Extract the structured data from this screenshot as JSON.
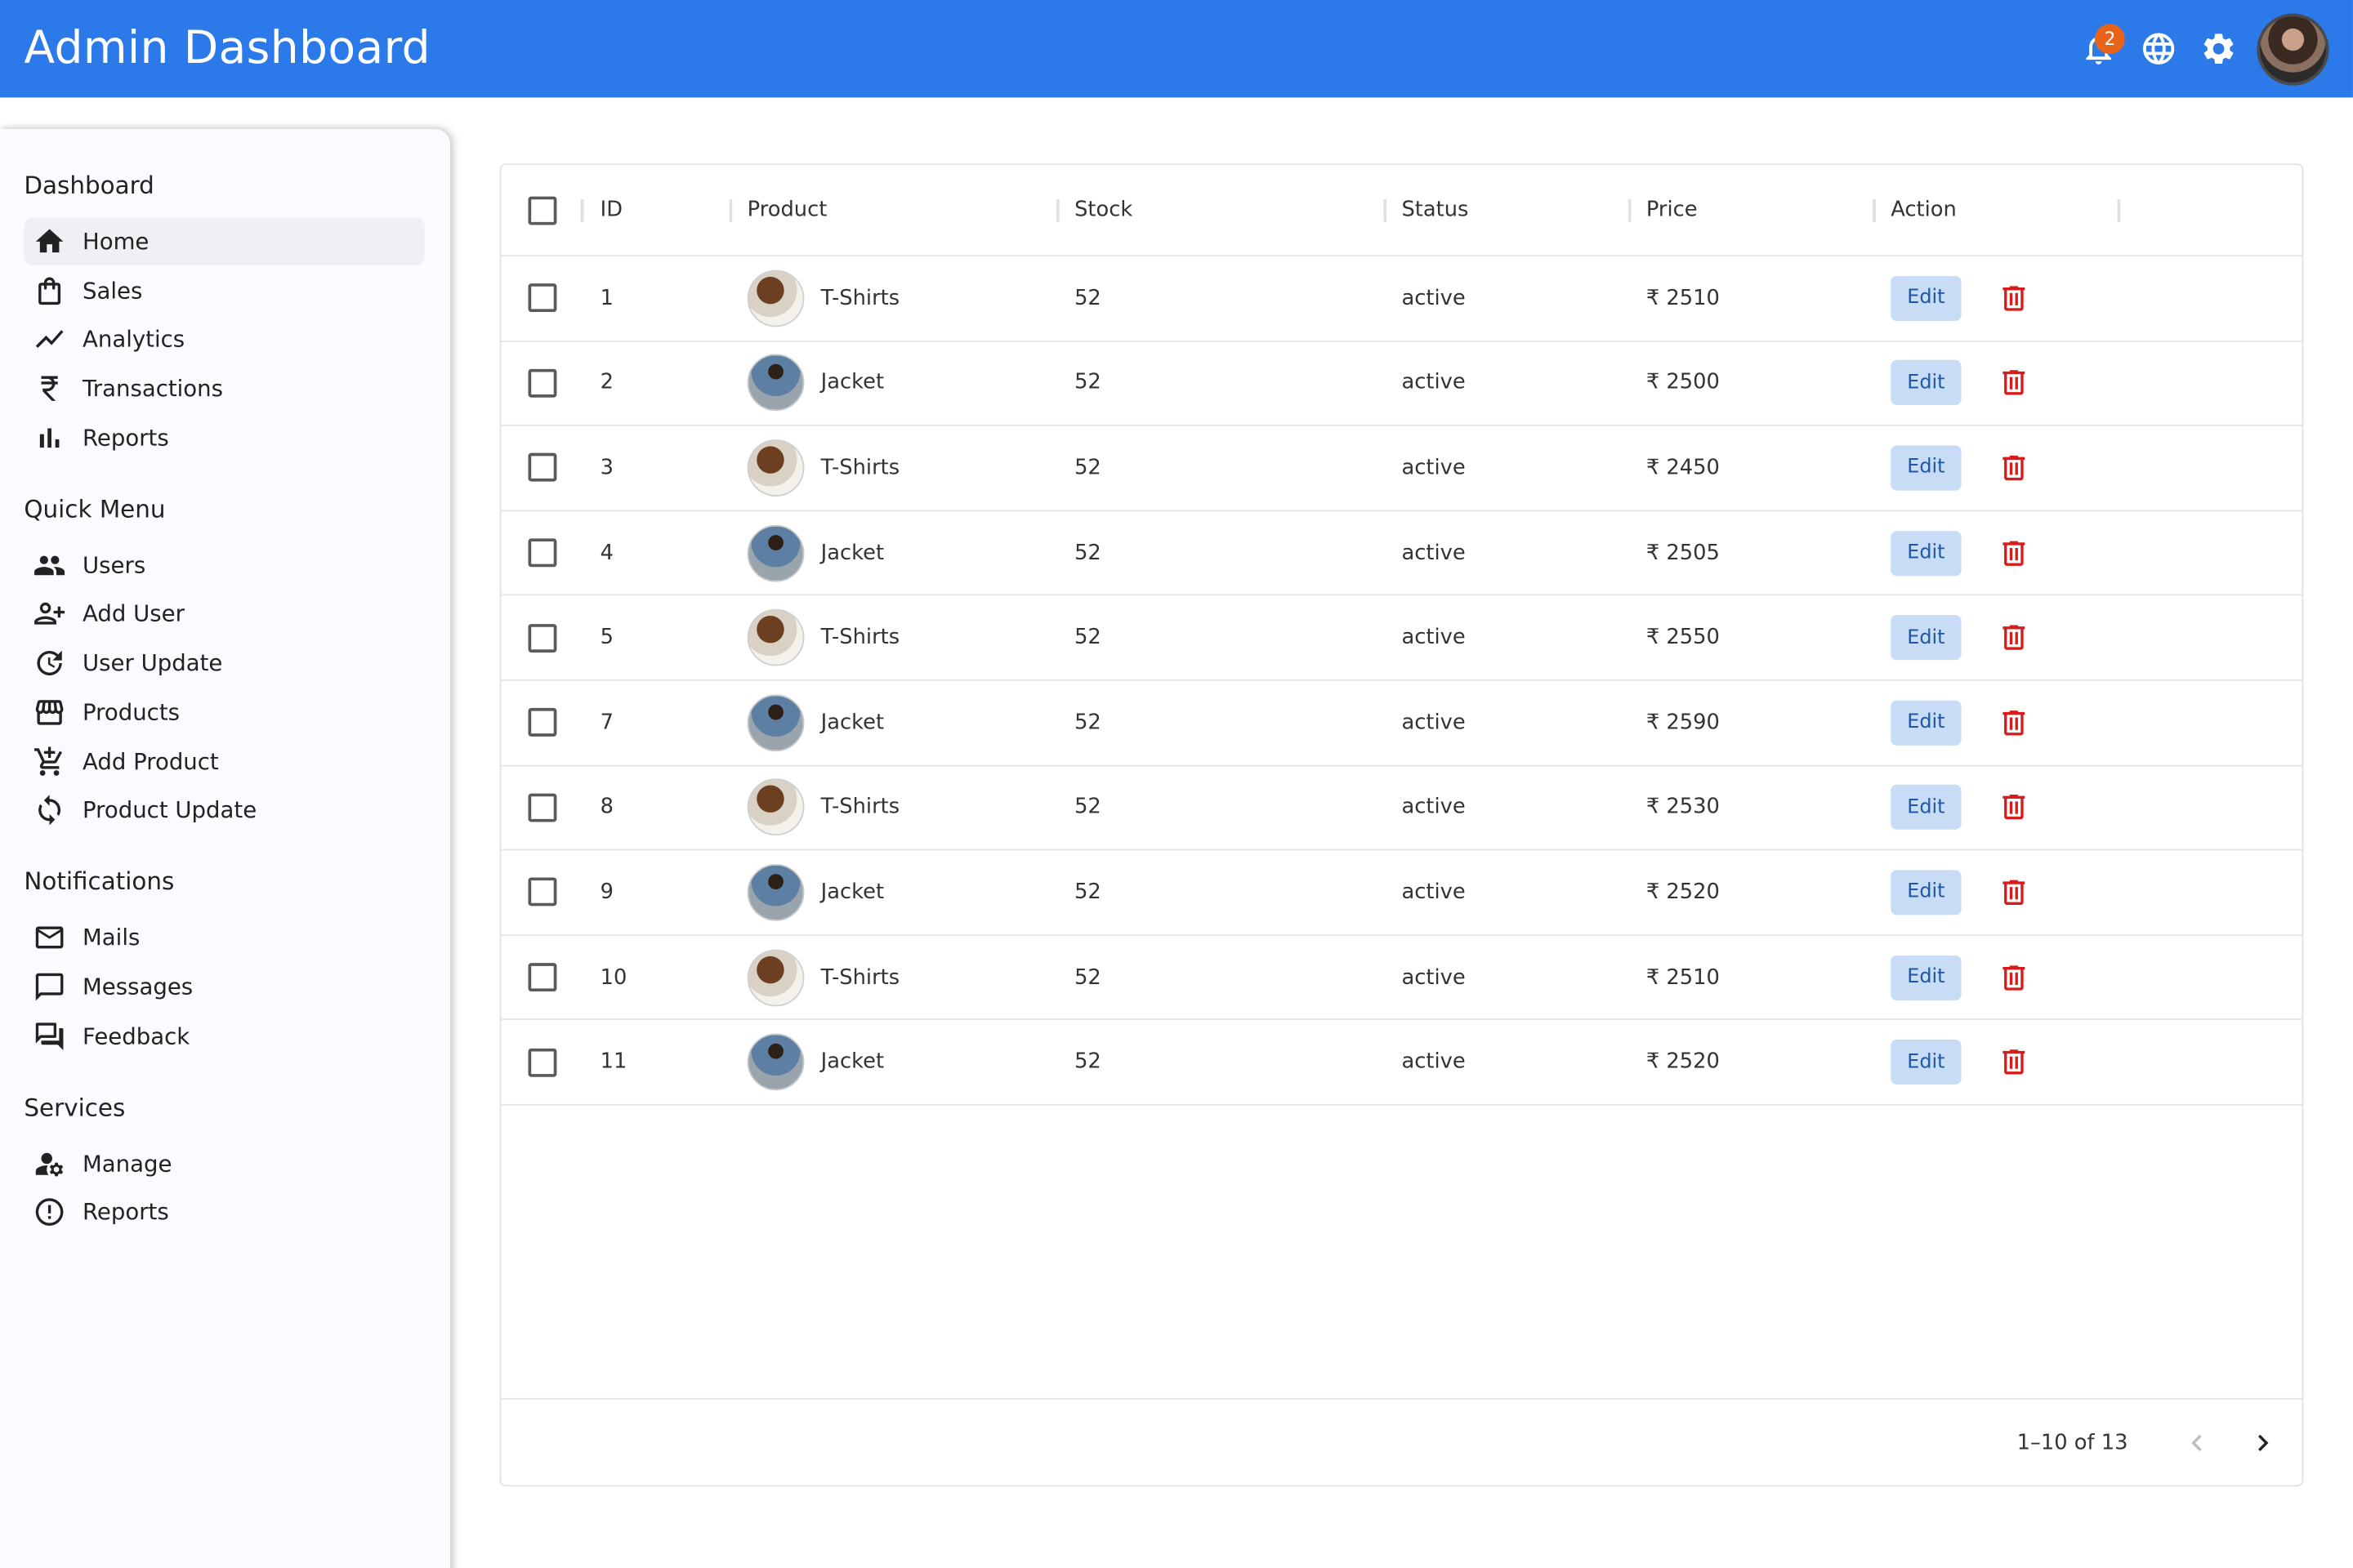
{
  "header": {
    "title": "Admin Dashboard",
    "notification_count": "2"
  },
  "sidebar": {
    "sections": [
      {
        "title": "Dashboard",
        "items": [
          {
            "label": "Home",
            "icon": "home-icon",
            "active": true
          },
          {
            "label": "Sales",
            "icon": "shopping-bag-icon"
          },
          {
            "label": "Analytics",
            "icon": "trending-line-icon"
          },
          {
            "label": "Transactions",
            "icon": "rupee-icon"
          },
          {
            "label": "Reports",
            "icon": "bar-chart-icon"
          }
        ]
      },
      {
        "title": "Quick Menu",
        "items": [
          {
            "label": "Users",
            "icon": "people-icon"
          },
          {
            "label": "Add User",
            "icon": "person-add-icon"
          },
          {
            "label": "User Update",
            "icon": "update-icon"
          },
          {
            "label": "Products",
            "icon": "storefront-icon"
          },
          {
            "label": "Add Product",
            "icon": "add-shopping-cart-icon"
          },
          {
            "label": "Product Update",
            "icon": "sync-icon"
          }
        ]
      },
      {
        "title": "Notifications",
        "items": [
          {
            "label": "Mails",
            "icon": "mail-icon"
          },
          {
            "label": "Messages",
            "icon": "chat-bubble-icon"
          },
          {
            "label": "Feedback",
            "icon": "forum-icon"
          }
        ]
      },
      {
        "title": "Services",
        "items": [
          {
            "label": "Manage",
            "icon": "manage-accounts-icon"
          },
          {
            "label": "Reports",
            "icon": "report-icon"
          }
        ]
      }
    ]
  },
  "table": {
    "columns": [
      "ID",
      "Product",
      "Stock",
      "Status",
      "Price",
      "Action"
    ],
    "edit_label": "Edit",
    "rows": [
      {
        "id": "1",
        "product": "T-Shirts",
        "image": "tshirt",
        "stock": "52",
        "status": "active",
        "price": "₹ 2510"
      },
      {
        "id": "2",
        "product": "Jacket",
        "image": "jacket",
        "stock": "52",
        "status": "active",
        "price": "₹ 2500"
      },
      {
        "id": "3",
        "product": "T-Shirts",
        "image": "tshirt",
        "stock": "52",
        "status": "active",
        "price": "₹ 2450"
      },
      {
        "id": "4",
        "product": "Jacket",
        "image": "jacket",
        "stock": "52",
        "status": "active",
        "price": "₹ 2505"
      },
      {
        "id": "5",
        "product": "T-Shirts",
        "image": "tshirt",
        "stock": "52",
        "status": "active",
        "price": "₹ 2550"
      },
      {
        "id": "7",
        "product": "Jacket",
        "image": "jacket",
        "stock": "52",
        "status": "active",
        "price": "₹ 2590"
      },
      {
        "id": "8",
        "product": "T-Shirts",
        "image": "tshirt",
        "stock": "52",
        "status": "active",
        "price": "₹ 2530"
      },
      {
        "id": "9",
        "product": "Jacket",
        "image": "jacket",
        "stock": "52",
        "status": "active",
        "price": "₹ 2520"
      },
      {
        "id": "10",
        "product": "T-Shirts",
        "image": "tshirt",
        "stock": "52",
        "status": "active",
        "price": "₹ 2510"
      },
      {
        "id": "11",
        "product": "Jacket",
        "image": "jacket",
        "stock": "52",
        "status": "active",
        "price": "₹ 2520"
      }
    ],
    "pagination": "1–10 of 13"
  },
  "colors": {
    "header": "#2c79ea",
    "badge": "#e8641b",
    "edit_bg": "#c8dcf5",
    "delete": "#d81b1b"
  }
}
